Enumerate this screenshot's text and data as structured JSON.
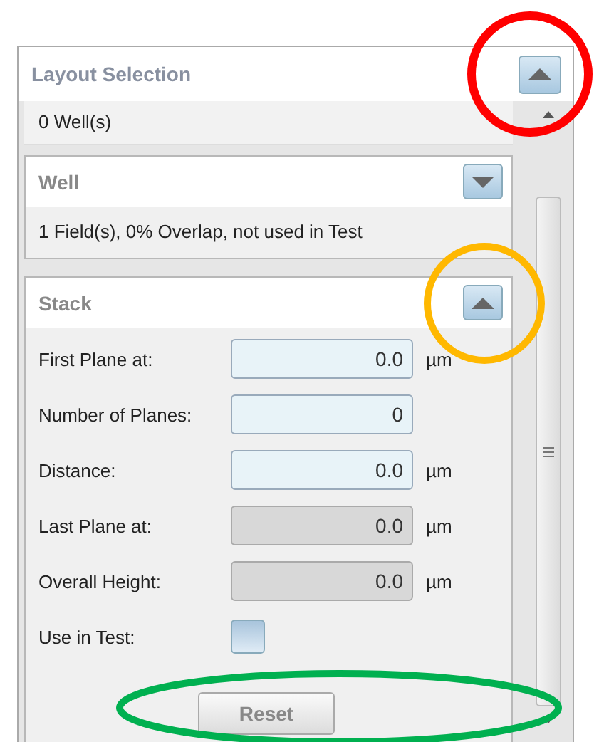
{
  "panel": {
    "title": "Layout Selection",
    "expanded": true,
    "summary": "0 Well(s)"
  },
  "sections": [
    {
      "title": "Well",
      "expanded": false,
      "summary": "1 Field(s), 0% Overlap, not used in Test"
    },
    {
      "title": "Stack",
      "expanded": true,
      "fields": [
        {
          "kind": "input",
          "label": "First Plane at:",
          "value": "0.0",
          "unit": "µm",
          "disabled": false
        },
        {
          "kind": "input",
          "label": "Number of Planes:",
          "value": "0",
          "disabled": false
        },
        {
          "kind": "input",
          "label": "Distance:",
          "value": "0.0",
          "unit": "µm",
          "disabled": false
        },
        {
          "kind": "input",
          "label": "Last Plane at:",
          "value": "0.0",
          "unit": "µm",
          "disabled": true
        },
        {
          "kind": "input",
          "label": "Overall Height:",
          "value": "0.0",
          "unit": "µm",
          "disabled": true
        },
        {
          "kind": "checkbox",
          "label": "Use in Test:",
          "checked": false
        }
      ],
      "button": "Reset"
    }
  ],
  "annotations": [
    {
      "kind": "circle",
      "color": "#ff0000"
    },
    {
      "kind": "circle",
      "color": "#ffb800"
    },
    {
      "kind": "ellipse",
      "color": "#00b050"
    }
  ]
}
